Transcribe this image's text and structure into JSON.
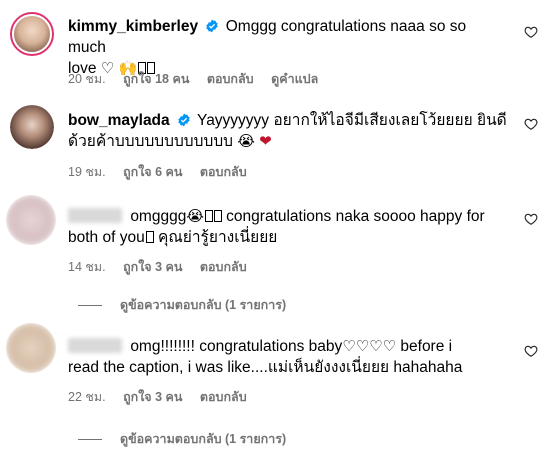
{
  "comments": [
    {
      "username": "kimmy_kimberley",
      "text_line1": "Omggg congratulations naaa so so much",
      "text_line2": "love",
      "time": "20 ชม.",
      "likes": "ถูกใจ 18 คน",
      "reply": "ตอบกลับ",
      "translate": "ดูคำแปล"
    },
    {
      "username": "bow_maylada",
      "text_line1": "Yayyyyyyy อยากให้ไอจีมีเสียงเลยโว้ยยยย ยินดี",
      "text_line2": "ด้วยค้าบบบบบบบบบบบบ",
      "time": "19 ชม.",
      "likes": "ถูกใจ 6 คน",
      "reply": "ตอบกลับ"
    },
    {
      "text_line1": "omgggg",
      "text_line1b": "congratulations naka soooo happy for",
      "text_line2": "both of you",
      "text_line2b": "คุณย่ารู้ยางเนี่ยยย",
      "time": "14 ชม.",
      "likes": "ถูกใจ 3 คน",
      "reply": "ตอบกลับ",
      "view_replies": "ดูข้อความตอบกลับ (1 รายการ)"
    },
    {
      "text_line1": "omg!!!!!!!! congratulations baby",
      "text_line1b": "before i",
      "text_line2": "read the caption, i was like....แม่เห็นยังงงเนี่ยยย hahahaha",
      "time": "22 ชม.",
      "likes": "ถูกใจ 3 คน",
      "reply": "ตอบกลับ",
      "view_replies": "ดูข้อความตอบกลับ (1 รายการ)"
    }
  ],
  "colors": {
    "meta": "#737373",
    "verified": "#0095f6",
    "ring": "#e1306c"
  }
}
